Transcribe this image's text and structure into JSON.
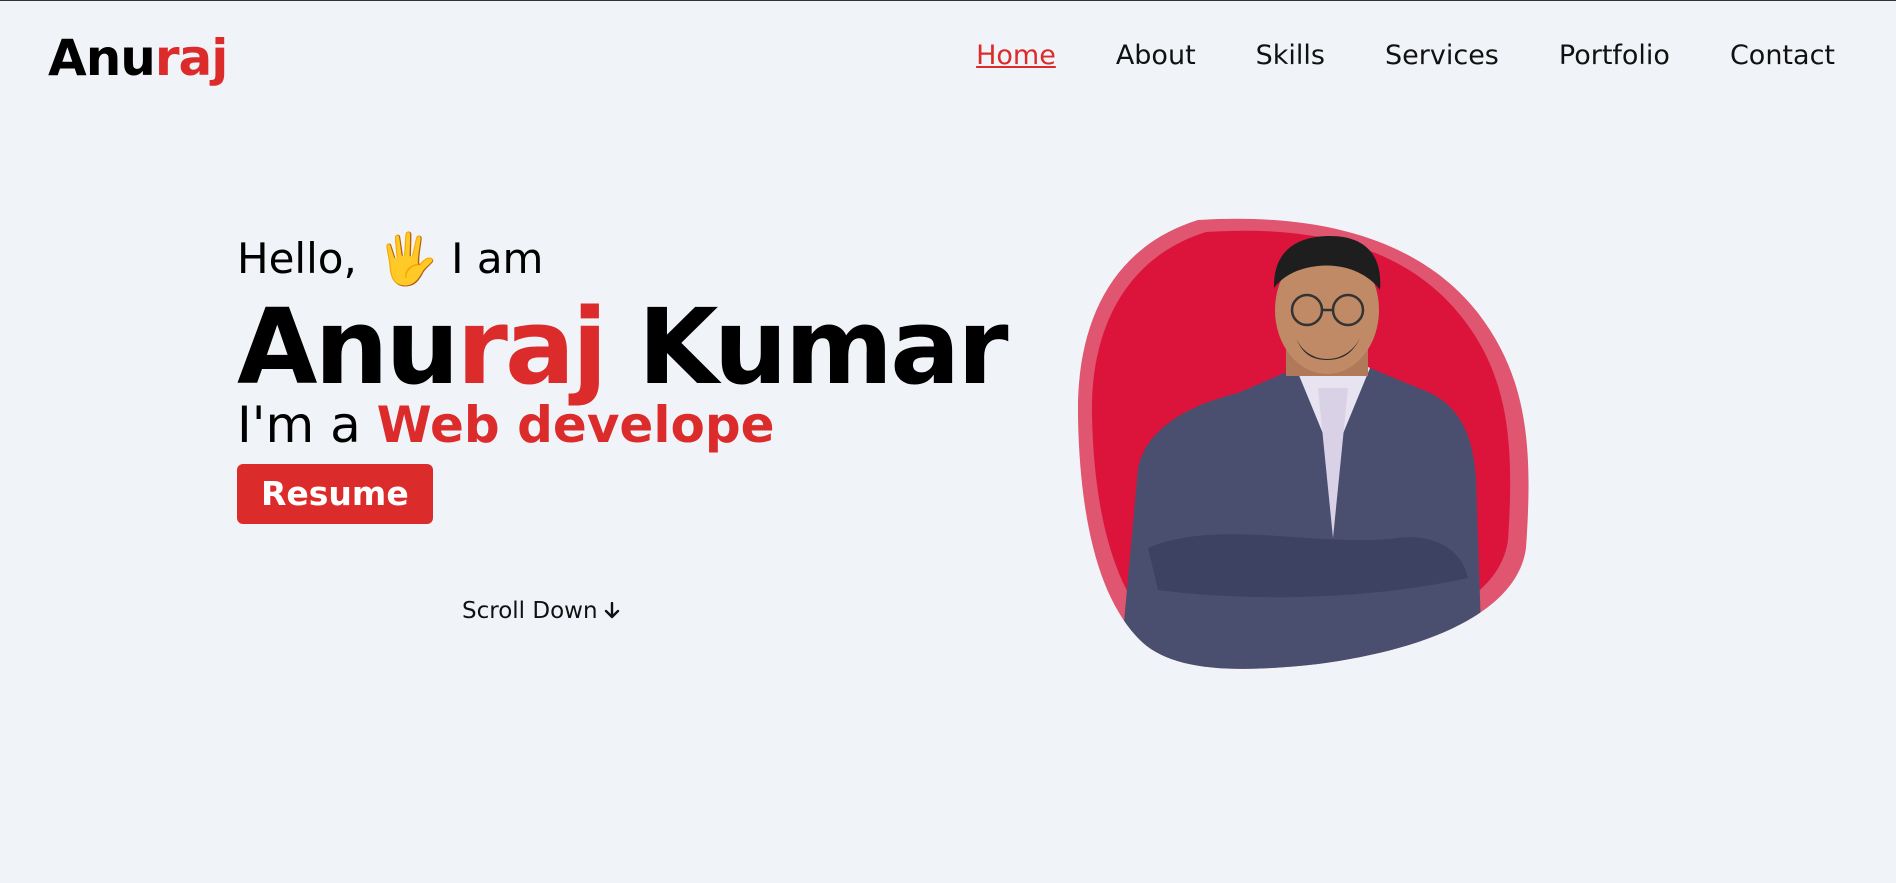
{
  "logo": {
    "part1": "Anu",
    "part2": "raj"
  },
  "nav": {
    "items": [
      {
        "label": "Home",
        "active": true
      },
      {
        "label": "About"
      },
      {
        "label": "Skills"
      },
      {
        "label": "Services"
      },
      {
        "label": "Portfolio"
      },
      {
        "label": "Contact"
      }
    ]
  },
  "hero": {
    "greeting_hello": "Hello,",
    "greeting_icon": "waving-hand-icon",
    "greeting_tail": "I am",
    "name_part1": "Anu",
    "name_part2": "raj",
    "name_last": "Kumar",
    "role_prefix": "I'm a",
    "role_typed": "Web develope",
    "resume_label": "Resume",
    "scroll_label": "Scroll Down",
    "scroll_icon": "arrow-down-icon"
  },
  "colors": {
    "background": "#f0f4f9",
    "accent": "#dc2b2b",
    "blob": "#dc143c"
  }
}
